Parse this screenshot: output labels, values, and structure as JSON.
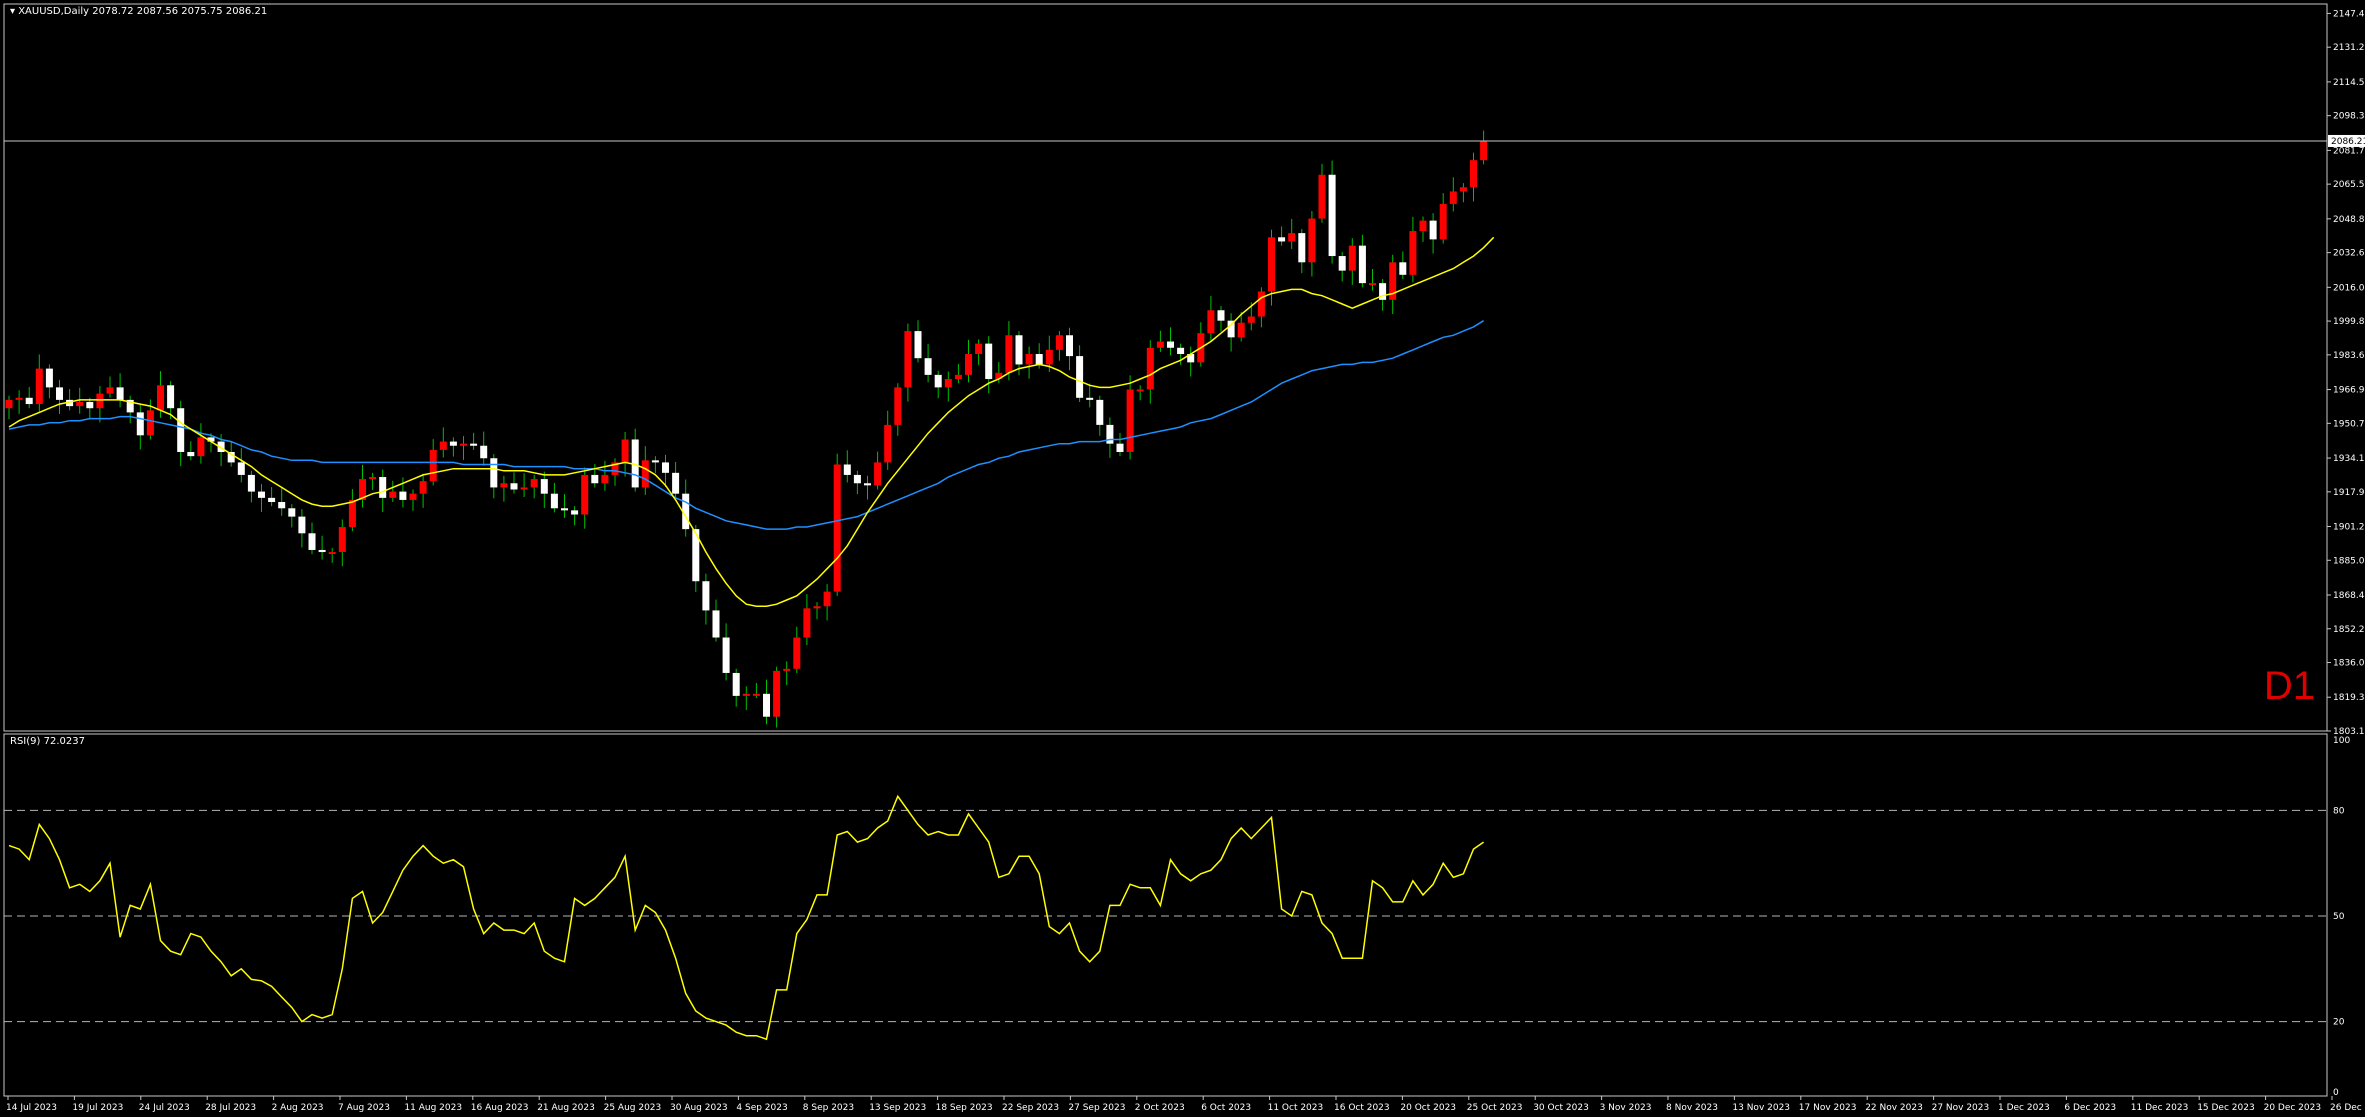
{
  "header": {
    "symbol_line": "XAUUSD,Daily  2078.72 2087.56 2075.75 2086.21",
    "rsi_line": "RSI(9) 72.0237",
    "timeframe": "D1"
  },
  "colors": {
    "background": "#000000",
    "bull": "#ffffff",
    "bear": "#ff0000",
    "ma_fast": "#ffff00",
    "ma_slow": "#1e90ff",
    "rsi": "#ffff00"
  },
  "chart_data": {
    "type": "candlestick",
    "price_axis": {
      "ylim": [
        1803.15,
        2150.0
      ],
      "ticks": [
        "2147.40",
        "2131.20",
        "2114.55",
        "2098.35",
        "2081.70",
        "2065.50",
        "2048.85",
        "2032.65",
        "2016.00",
        "1999.80",
        "1983.60",
        "1966.95",
        "1950.75",
        "1934.10",
        "1917.90",
        "1901.25",
        "1885.05",
        "1868.40",
        "1852.20",
        "1836.00",
        "1819.35",
        "1803.15"
      ],
      "current_price": "2086.21"
    },
    "x_labels": [
      "14 Jul 2023",
      "19 Jul 2023",
      "24 Jul 2023",
      "28 Jul 2023",
      "2 Aug 2023",
      "7 Aug 2023",
      "11 Aug 2023",
      "16 Aug 2023",
      "21 Aug 2023",
      "25 Aug 2023",
      "30 Aug 2023",
      "4 Sep 2023",
      "8 Sep 2023",
      "13 Sep 2023",
      "18 Sep 2023",
      "22 Sep 2023",
      "27 Sep 2023",
      "2 Oct 2023",
      "6 Oct 2023",
      "11 Oct 2023",
      "16 Oct 2023",
      "20 Oct 2023",
      "25 Oct 2023",
      "30 Oct 2023",
      "3 Nov 2023",
      "8 Nov 2023",
      "13 Nov 2023",
      "17 Nov 2023",
      "22 Nov 2023",
      "27 Nov 2023",
      "1 Dec 2023",
      "6 Dec 2023",
      "11 Dec 2023",
      "15 Dec 2023",
      "20 Dec 2023",
      "26 Dec 2023"
    ],
    "close": [
      1962,
      1963,
      1960,
      1977,
      1968,
      1962,
      1959,
      1961,
      1958,
      1965,
      1968,
      1962,
      1956,
      1945,
      1957,
      1969,
      1958,
      1937,
      1935,
      1944,
      1942,
      1937,
      1932,
      1926,
      1918,
      1915,
      1913,
      1910,
      1906,
      1898,
      1890,
      1889,
      1889,
      1901,
      1914,
      1924,
      1925,
      1915,
      1918,
      1914,
      1917,
      1923,
      1938,
      1942,
      1940,
      1941,
      1940,
      1934,
      1920,
      1922,
      1919,
      1920,
      1924,
      1917,
      1910,
      1909,
      1907,
      1926,
      1922,
      1926,
      1932,
      1943,
      1920,
      1933,
      1932,
      1927,
      1917,
      1900,
      1875,
      1861,
      1848,
      1831,
      1820,
      1821,
      1821,
      1810,
      1832,
      1833,
      1848,
      1862,
      1863,
      1870,
      1931,
      1926,
      1922,
      1921,
      1932,
      1950,
      1968,
      1995,
      1982,
      1974,
      1968,
      1972,
      1974,
      1984,
      1989,
      1972,
      1975,
      1993,
      1979,
      1984,
      1979,
      1986,
      1993,
      1983,
      1963,
      1962,
      1950,
      1941,
      1937,
      1967,
      1967,
      1987,
      1990,
      1987,
      1984,
      1980,
      1994,
      2005,
      2000,
      1992,
      1999,
      2002,
      2014,
      2040,
      2038,
      2042,
      2028,
      2049,
      2070,
      2031,
      2024,
      2036,
      2018,
      2018,
      2010,
      2028,
      2022,
      2043,
      2048,
      2039,
      2056,
      2062,
      2064,
      2077,
      2086
    ],
    "ma_fast": [
      1949,
      1952,
      1954,
      1956,
      1958,
      1960,
      1961,
      1962,
      1962,
      1962,
      1962,
      1962,
      1961,
      1960,
      1959,
      1957,
      1955,
      1951,
      1948,
      1945,
      1942,
      1939,
      1936,
      1933,
      1930,
      1926,
      1923,
      1920,
      1917,
      1914,
      1912,
      1911,
      1911,
      1912,
      1913,
      1915,
      1917,
      1918,
      1920,
      1922,
      1924,
      1926,
      1927,
      1928,
      1929,
      1929,
      1929,
      1929,
      1929,
      1928,
      1928,
      1928,
      1927,
      1926,
      1926,
      1926,
      1927,
      1928,
      1929,
      1930,
      1931,
      1932,
      1931,
      1929,
      1926,
      1921,
      1914,
      1906,
      1898,
      1889,
      1881,
      1874,
      1868,
      1864,
      1863,
      1863,
      1864,
      1866,
      1868,
      1872,
      1876,
      1881,
      1886,
      1892,
      1900,
      1908,
      1915,
      1922,
      1928,
      1934,
      1940,
      1946,
      1951,
      1956,
      1960,
      1964,
      1967,
      1970,
      1972,
      1975,
      1977,
      1978,
      1979,
      1978,
      1976,
      1973,
      1971,
      1969,
      1968,
      1968,
      1969,
      1970,
      1972,
      1974,
      1977,
      1979,
      1981,
      1984,
      1987,
      1990,
      1994,
      1998,
      2003,
      2007,
      2011,
      2013,
      2014,
      2015,
      2015,
      2013,
      2012,
      2010,
      2008,
      2006,
      2008,
      2010,
      2012,
      2013,
      2015,
      2017,
      2019,
      2021,
      2023,
      2025,
      2028,
      2031,
      2035,
      2040
    ],
    "ma_slow": [
      1948,
      1949,
      1950,
      1950,
      1951,
      1951,
      1952,
      1952,
      1953,
      1953,
      1953,
      1954,
      1954,
      1953,
      1952,
      1951,
      1950,
      1949,
      1948,
      1946,
      1945,
      1943,
      1942,
      1940,
      1938,
      1937,
      1935,
      1934,
      1933,
      1933,
      1933,
      1932,
      1932,
      1932,
      1932,
      1932,
      1932,
      1932,
      1932,
      1932,
      1932,
      1932,
      1932,
      1932,
      1932,
      1931,
      1931,
      1931,
      1931,
      1931,
      1930,
      1930,
      1930,
      1930,
      1930,
      1930,
      1929,
      1929,
      1929,
      1928,
      1928,
      1927,
      1926,
      1924,
      1921,
      1918,
      1915,
      1913,
      1910,
      1908,
      1906,
      1904,
      1903,
      1902,
      1901,
      1900,
      1900,
      1900,
      1901,
      1901,
      1902,
      1903,
      1904,
      1905,
      1906,
      1908,
      1910,
      1912,
      1914,
      1916,
      1918,
      1920,
      1922,
      1925,
      1927,
      1929,
      1931,
      1932,
      1934,
      1935,
      1937,
      1938,
      1939,
      1940,
      1941,
      1941,
      1942,
      1942,
      1942,
      1943,
      1943,
      1944,
      1945,
      1946,
      1947,
      1948,
      1949,
      1951,
      1952,
      1953,
      1955,
      1957,
      1959,
      1961,
      1964,
      1967,
      1970,
      1972,
      1974,
      1976,
      1977,
      1978,
      1979,
      1979,
      1980,
      1980,
      1981,
      1982,
      1984,
      1986,
      1988,
      1990,
      1992,
      1993,
      1995,
      1997,
      2000
    ],
    "rsi": {
      "label": "RSI(9) 72.0237",
      "ylim": [
        0,
        100
      ],
      "ticks": [
        "100",
        "80",
        "50",
        "20",
        "0"
      ],
      "levels": [
        80,
        50,
        20
      ],
      "values": [
        70.0,
        69.0,
        66.0,
        76.0,
        72.0,
        66.0,
        58.0,
        59.0,
        57.0,
        60.0,
        65.0,
        44.0,
        53.0,
        52.0,
        59.0,
        43.0,
        40.0,
        39.0,
        45.0,
        44.0,
        40.0,
        37.0,
        33.0,
        35.0,
        32.0,
        31.6,
        30.0,
        27.0,
        24.0,
        20.0,
        22.0,
        21.0,
        22.0,
        35.0,
        55.0,
        57.0,
        48.0,
        51.0,
        57.0,
        63.0,
        67.0,
        70.0,
        67.0,
        65.0,
        66.0,
        64.0,
        52.0,
        45.0,
        48.0,
        46.0,
        46.0,
        45.0,
        48.0,
        40.0,
        38.0,
        37.0,
        55.0,
        53.0,
        55.0,
        58.0,
        61.0,
        67.0,
        46.0,
        53.0,
        51.0,
        46.0,
        38.0,
        28.0,
        23.0,
        21.0,
        20.0,
        19.0,
        17.0,
        16.0,
        16.0,
        15.0,
        29.0,
        29.0,
        45.0,
        49.0,
        56.0,
        56.0,
        73.0,
        74.0,
        71.0,
        72.0,
        75.0,
        77.0,
        84.0,
        80.0,
        76.0,
        73.0,
        74.0,
        73.0,
        73.0,
        79.0,
        75.0,
        71.0,
        61.0,
        62.0,
        67.0,
        67.0,
        62.0,
        47.0,
        45.0,
        48.0,
        40.0,
        37.0,
        40.0,
        53.0,
        53.0,
        59.0,
        58.0,
        58.0,
        53.0,
        66.0,
        62.0,
        60.0,
        62.0,
        63.0,
        66.0,
        72.0,
        75.0,
        72.0,
        75.0,
        78.0,
        52.0,
        50.0,
        57.0,
        56.0,
        48.0,
        45.0,
        38.0,
        38.0,
        38.0,
        60.0,
        58.0,
        54.0,
        54.0,
        60.0,
        56.0,
        59.0,
        65.0,
        61.0,
        62.0,
        69.0,
        71.0
      ]
    }
  }
}
